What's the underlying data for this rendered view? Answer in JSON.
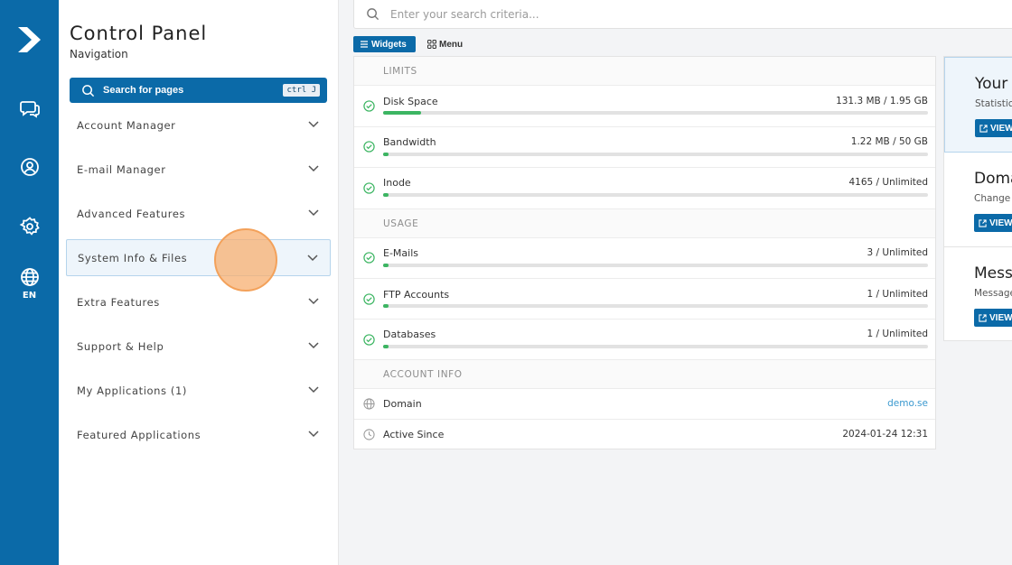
{
  "rail": {
    "icons": [
      "logo-icon",
      "chat-icon",
      "user-icon",
      "gear-icon",
      "globe-icon"
    ],
    "lang": "EN"
  },
  "nav": {
    "title": "Control Panel",
    "subtitle": "Navigation",
    "search_label": "Search for pages",
    "shortcut": "ctrl J",
    "items": [
      {
        "label": "Account Manager"
      },
      {
        "label": "E-mail Manager"
      },
      {
        "label": "Advanced Features"
      },
      {
        "label": "System Info & Files"
      },
      {
        "label": "Extra Features"
      },
      {
        "label": "Support & Help"
      },
      {
        "label": "My Applications (1)"
      },
      {
        "label": "Featured Applications"
      }
    ],
    "active_item": "System Info & Files"
  },
  "search": {
    "placeholder": "Enter your search criteria..."
  },
  "tabs": {
    "widgets": "Widgets",
    "menu": "Menu",
    "active": "Widgets"
  },
  "widgets": {
    "limits_title": "LIMITS",
    "usage_title": "USAGE",
    "account_title": "ACCOUNT INFO",
    "limits": [
      {
        "label": "Disk Space",
        "value": "131.3 MB / 1.95 GB",
        "progress": 0.07
      },
      {
        "label": "Bandwidth",
        "value": "1.22 MB / 50 GB",
        "progress": 0.01
      },
      {
        "label": "Inode",
        "value": "4165 / Unlimited",
        "progress": 0.01
      }
    ],
    "usage": [
      {
        "label": "E-Mails",
        "value": "3 / Unlimited",
        "progress": 0.01
      },
      {
        "label": "FTP Accounts",
        "value": "1 / Unlimited",
        "progress": 0.01
      },
      {
        "label": "Databases",
        "value": "1 / Unlimited",
        "progress": 0.01
      }
    ],
    "account": [
      {
        "label": "Domain",
        "value": "demo.se"
      },
      {
        "label": "Active Since",
        "value": "2024-01-24 12:31"
      }
    ]
  },
  "cards": [
    {
      "title": "Your",
      "subtitle": "Statistics",
      "button": "VIEW"
    },
    {
      "title": "Doma",
      "subtitle": "Change",
      "button": "VIEW"
    },
    {
      "title": "Mess",
      "subtitle": "Message",
      "button": "VIEW"
    }
  ],
  "colors": {
    "primary": "#0b6aa8",
    "success": "#3cb562",
    "link": "#3a98cf",
    "cursor": "#f7af70"
  }
}
